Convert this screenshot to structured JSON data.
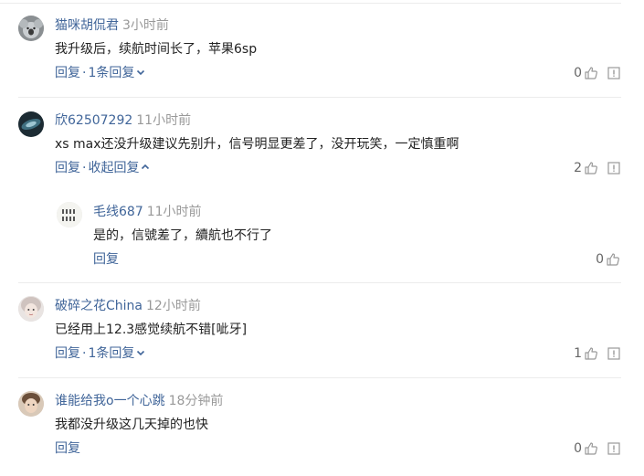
{
  "comments": [
    {
      "user": "猫咪胡侃君",
      "time": "3小时前",
      "text": "我升级后，续航时间长了，苹果6sp",
      "reply_label": "回复",
      "separator": "·",
      "toggle_label": "1条回复",
      "likes": "0"
    },
    {
      "user": "欣62507292",
      "time": "11小时前",
      "text": "xs max还没升级建议先别升，信号明显更差了，没开玩笑，一定慎重啊",
      "reply_label": "回复",
      "separator": "·",
      "toggle_label": "收起回复",
      "likes": "2",
      "reply": {
        "user": "毛线687",
        "time": "11小时前",
        "text": "是的，信號差了，續航也不行了",
        "reply_label": "回复",
        "likes": "0"
      }
    },
    {
      "user": "破碎之花China",
      "time": "12小时前",
      "text": "已经用上12.3感觉续航不错[呲牙]",
      "reply_label": "回复",
      "separator": "·",
      "toggle_label": "1条回复",
      "likes": "1"
    },
    {
      "user": "谁能给我o一个心跳",
      "time": "18分钟前",
      "text": "我都没升级这几天掉的也快",
      "reply_label": "回复",
      "likes": "0"
    }
  ],
  "colors": {
    "link": "#406599",
    "time": "#999999",
    "text": "#222222",
    "icon": "#999999"
  },
  "icons": {
    "like": "thumbs-up-icon",
    "report": "report-icon",
    "expand": "chevron-down-icon",
    "collapse": "chevron-up-icon"
  }
}
